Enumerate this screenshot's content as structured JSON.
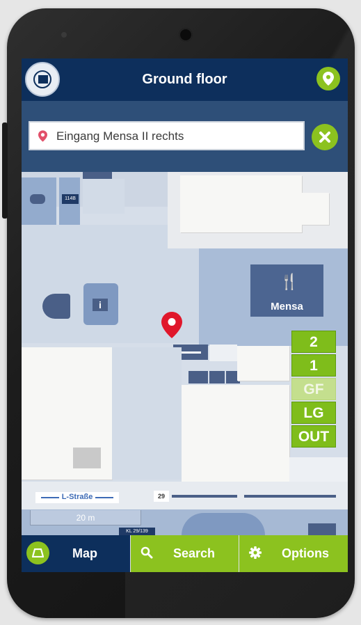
{
  "header": {
    "title": "Ground floor"
  },
  "search": {
    "value": "Eingang Mensa II rechts"
  },
  "map": {
    "mensa_label": "Mensa",
    "room_labels": [
      "114B",
      "29",
      "KL 29/139"
    ],
    "street_label": "L-Straße",
    "scale_label": "20 m"
  },
  "floors": [
    {
      "label": "2",
      "active": false
    },
    {
      "label": "1",
      "active": false
    },
    {
      "label": "GF",
      "active": true
    },
    {
      "label": "LG",
      "active": false
    },
    {
      "label": "OUT",
      "active": false
    }
  ],
  "bottom_nav": {
    "map_label": "Map",
    "search_label": "Search",
    "options_label": "Options"
  },
  "colors": {
    "header_bg": "#0d2f5c",
    "accent_green": "#8cc21f",
    "marker_red": "#e0172b"
  },
  "icons": [
    "logo",
    "location-pin-icon",
    "clear-icon",
    "coffee-icon",
    "info-icon",
    "fork-knife-icon",
    "map-pin-icon",
    "map-icon",
    "search-icon",
    "gear-icon"
  ]
}
